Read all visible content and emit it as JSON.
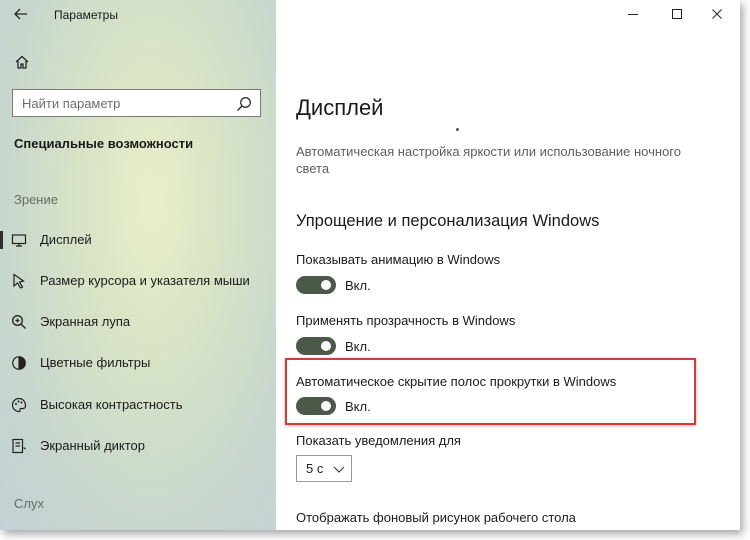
{
  "window": {
    "title": "Параметры",
    "controls": [
      "minimize-icon",
      "maximize-icon",
      "close-icon"
    ]
  },
  "sidebar": {
    "search_placeholder": "Найти параметр",
    "category": "Специальные возможности",
    "section_vision": "Зрение",
    "section_hearing": "Слух",
    "items": [
      {
        "label": "Дисплей",
        "icon": "monitor-icon",
        "selected": true
      },
      {
        "label": "Размер курсора и указателя мыши",
        "icon": "cursor-icon",
        "selected": false
      },
      {
        "label": "Экранная лупа",
        "icon": "magnifier-icon",
        "selected": false
      },
      {
        "label": "Цветные фильтры",
        "icon": "color-filter-icon",
        "selected": false
      },
      {
        "label": "Высокая контрастность",
        "icon": "palette-icon",
        "selected": false
      },
      {
        "label": "Экранный диктор",
        "icon": "narrator-icon",
        "selected": false
      }
    ]
  },
  "main": {
    "page_title": "Дисплей",
    "brightness_description": "Автоматическая настройка яркости или использование ночного света",
    "section_heading": "Упрощение и персонализация Windows",
    "settings": [
      {
        "label": "Показывать анимацию в Windows",
        "state": "Вкл.",
        "on": true
      },
      {
        "label": "Применять прозрачность в Windows",
        "state": "Вкл.",
        "on": true
      },
      {
        "label": "Автоматическое скрытие полос прокрутки в Windows",
        "state": "Вкл.",
        "on": true
      }
    ],
    "notifications_label": "Показать уведомления для",
    "notifications_value": "5 с",
    "wallpaper_label": "Отображать фоновый рисунок рабочего стола"
  },
  "colors": {
    "toggle_on": "#4b5a48",
    "highlight_border": "#d33a3a"
  }
}
